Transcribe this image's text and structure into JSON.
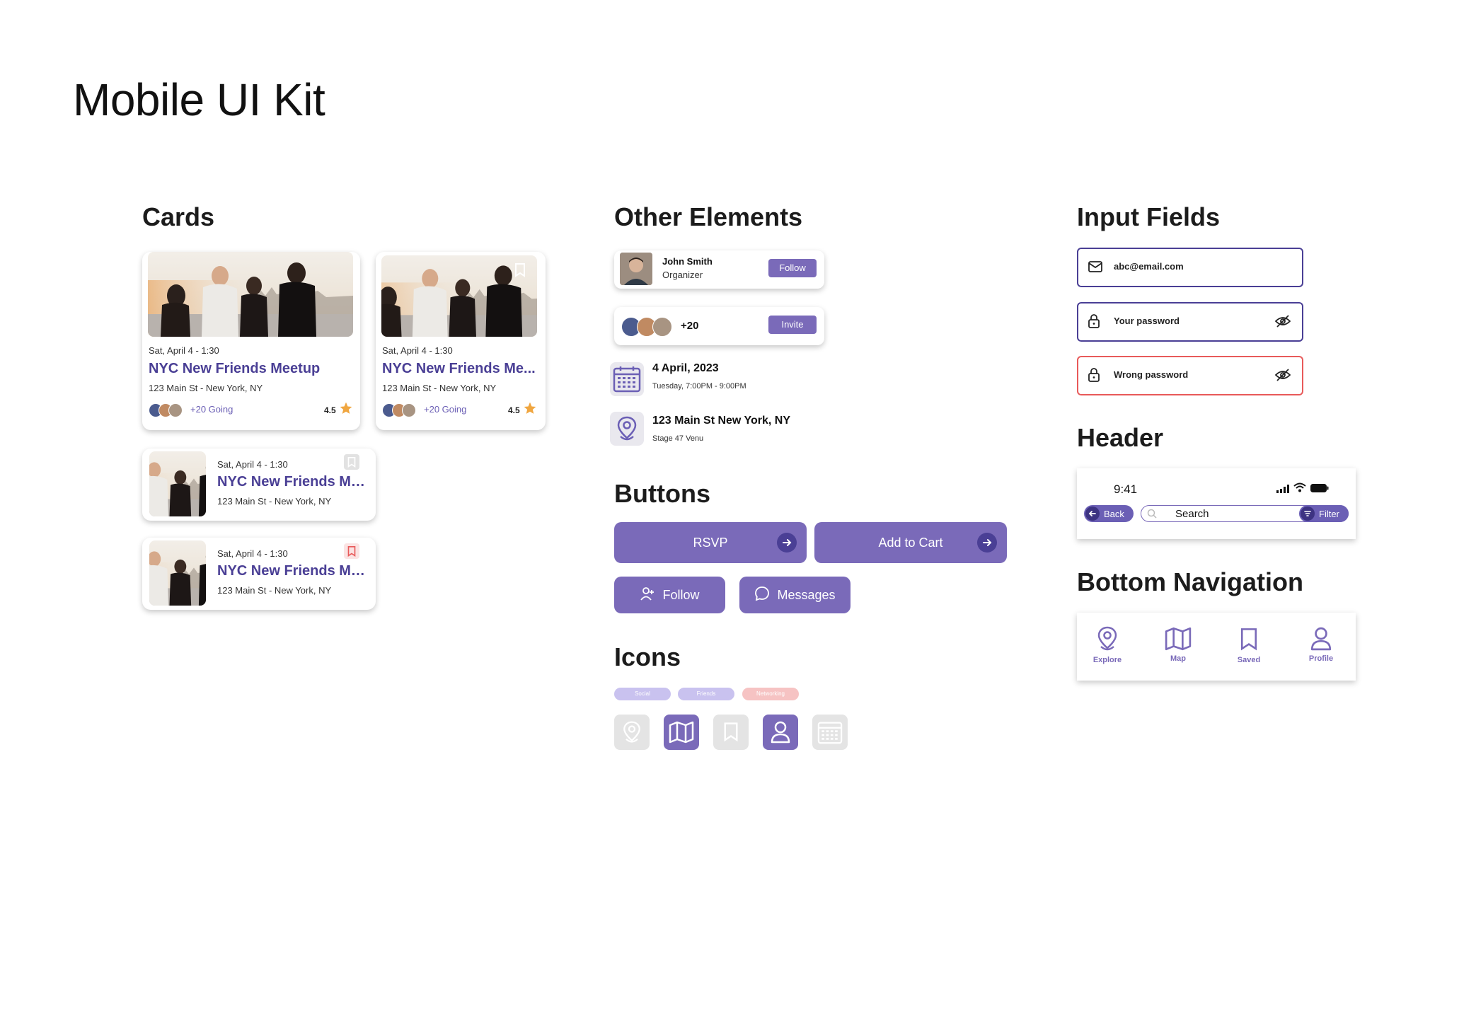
{
  "page": {
    "title": "Mobile UI Kit"
  },
  "sections": {
    "cards": "Cards",
    "other": "Other Elements",
    "inputs": "Input Fields",
    "header": "Header",
    "buttons": "Buttons",
    "bottom_nav": "Bottom Navigation",
    "icons": "Icons"
  },
  "cards": [
    {
      "date": "Sat, April 4 - 1:30",
      "title": "NYC New Friends Meetup",
      "address": "123 Main St - New York, NY",
      "going": "+20 Going",
      "rating": "4.5"
    },
    {
      "date": "Sat, April 4 - 1:30",
      "title": "NYC New Friends Me...",
      "address": "123 Main St - New York, NY",
      "going": "+20 Going",
      "rating": "4.5"
    },
    {
      "date": "Sat, April 4 - 1:30",
      "title": "NYC New Friends Me...",
      "address": "123 Main St - New York, NY"
    },
    {
      "date": "Sat, April 4 - 1:30",
      "title": "NYC New Friends Me...",
      "address": "123 Main St - New York, NY"
    }
  ],
  "other": {
    "organizer_name": "John Smith",
    "organizer_role": "Organizer",
    "follow": "Follow",
    "attendee_count": "+20",
    "invite": "Invite",
    "date_main": "4 April, 2023",
    "date_sub": "Tuesday, 7:00PM - 9:00PM",
    "location_main": "123 Main St New York, NY",
    "location_sub": "Stage 47 Venu"
  },
  "buttons": {
    "rsvp": "RSVP",
    "add_to_cart": "Add to Cart",
    "follow": "Follow",
    "messages": "Messages"
  },
  "chips": [
    "Social",
    "Friends",
    "Networking"
  ],
  "icons": [
    "location-icon",
    "map-icon",
    "bookmark-icon",
    "profile-icon",
    "calendar-icon"
  ],
  "inputs": {
    "email": "abc@email.com",
    "password": "Your password",
    "wrong": "Wrong password"
  },
  "header": {
    "time": "9:41",
    "back": "Back",
    "search": "Search",
    "filter": "Filter"
  },
  "bottom_nav": [
    "Explore",
    "Map",
    "Saved",
    "Profile"
  ],
  "colors": {
    "primary": "#7a6ab9",
    "dark": "#4a3f95",
    "error": "#e85a5a",
    "star": "#f0a640"
  }
}
